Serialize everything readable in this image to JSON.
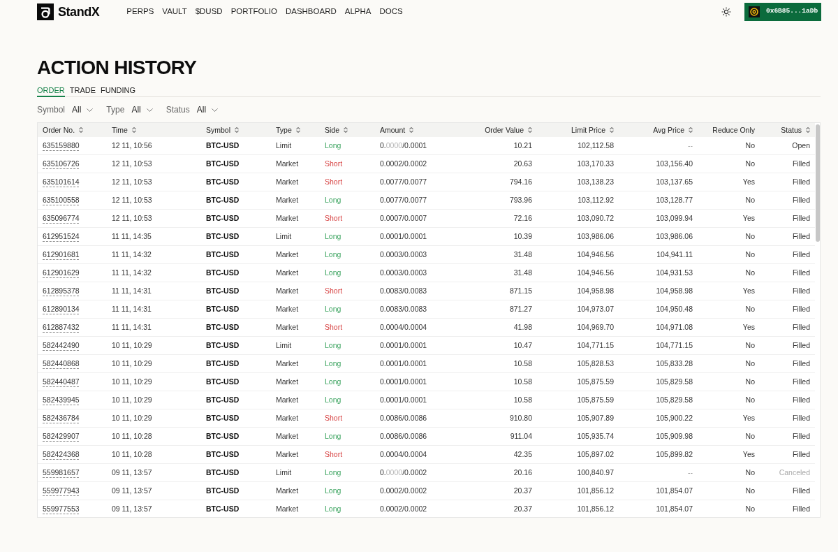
{
  "header": {
    "logo": "StandX",
    "nav": [
      "PERPS",
      "VAULT",
      "$DUSD",
      "PORTFOLIO",
      "DASHBOARD",
      "ALPHA",
      "DOCS"
    ],
    "wallet_address": "0x6B85...1aDb"
  },
  "page_title": "ACTION HISTORY",
  "tabs": [
    {
      "label": "ORDER",
      "selected": true
    },
    {
      "label": "TRADE",
      "selected": false
    },
    {
      "label": "FUNDING",
      "selected": false
    }
  ],
  "filters": [
    {
      "label": "Symbol",
      "value": "All"
    },
    {
      "label": "Type",
      "value": "All"
    },
    {
      "label": "Status",
      "value": "All"
    }
  ],
  "table": {
    "columns": [
      {
        "label": "Order No.",
        "sortable": true
      },
      {
        "label": "Time",
        "sortable": true
      },
      {
        "label": "Symbol",
        "sortable": true
      },
      {
        "label": "Type",
        "sortable": true
      },
      {
        "label": "Side",
        "sortable": true
      },
      {
        "label": "Amount",
        "sortable": true
      },
      {
        "label": "Order Value",
        "sortable": true
      },
      {
        "label": "Limit Price",
        "sortable": true
      },
      {
        "label": "Avg Price",
        "sortable": true
      },
      {
        "label": "Reduce Only",
        "sortable": false
      },
      {
        "label": "Status",
        "sortable": true
      }
    ],
    "rows": [
      {
        "order_no": "635159880",
        "time": "12 11, 10:56",
        "symbol": "BTC-USD",
        "type": "Limit",
        "side": {
          "label": "Long",
          "color": "#3aa35e"
        },
        "amount": [
          {
            "text": "0.",
            "faded": false
          },
          {
            "text": "0000",
            "faded": true
          },
          {
            "text": "/0.0001",
            "faded": false
          }
        ],
        "order_value": "10.21",
        "limit_price": "102,112.58",
        "avg_price": "--",
        "avg_muted": true,
        "reduce_only": "No",
        "status": "Open",
        "status_muted": false
      },
      {
        "order_no": "635106726",
        "time": "12 11, 10:53",
        "symbol": "BTC-USD",
        "type": "Market",
        "side": {
          "label": "Short",
          "color": "#d63f3f"
        },
        "amount": [
          {
            "text": "0.0002/0.0002",
            "faded": false
          }
        ],
        "order_value": "20.63",
        "limit_price": "103,170.33",
        "avg_price": "103,156.40",
        "avg_muted": false,
        "reduce_only": "No",
        "status": "Filled",
        "status_muted": false
      },
      {
        "order_no": "635101614",
        "time": "12 11, 10:53",
        "symbol": "BTC-USD",
        "type": "Market",
        "side": {
          "label": "Short",
          "color": "#d63f3f"
        },
        "amount": [
          {
            "text": "0.0077/0.0077",
            "faded": false
          }
        ],
        "order_value": "794.16",
        "limit_price": "103,138.23",
        "avg_price": "103,137.65",
        "avg_muted": false,
        "reduce_only": "Yes",
        "status": "Filled",
        "status_muted": false
      },
      {
        "order_no": "635100558",
        "time": "12 11, 10:53",
        "symbol": "BTC-USD",
        "type": "Market",
        "side": {
          "label": "Long",
          "color": "#3aa35e"
        },
        "amount": [
          {
            "text": "0.0077/0.0077",
            "faded": false
          }
        ],
        "order_value": "793.96",
        "limit_price": "103,112.92",
        "avg_price": "103,128.77",
        "avg_muted": false,
        "reduce_only": "No",
        "status": "Filled",
        "status_muted": false
      },
      {
        "order_no": "635096774",
        "time": "12 11, 10:53",
        "symbol": "BTC-USD",
        "type": "Market",
        "side": {
          "label": "Short",
          "color": "#d63f3f"
        },
        "amount": [
          {
            "text": "0.0007/0.0007",
            "faded": false
          }
        ],
        "order_value": "72.16",
        "limit_price": "103,090.72",
        "avg_price": "103,099.94",
        "avg_muted": false,
        "reduce_only": "Yes",
        "status": "Filled",
        "status_muted": false
      },
      {
        "order_no": "612951524",
        "time": "11 11, 14:35",
        "symbol": "BTC-USD",
        "type": "Limit",
        "side": {
          "label": "Long",
          "color": "#3aa35e"
        },
        "amount": [
          {
            "text": "0.0001/0.0001",
            "faded": false
          }
        ],
        "order_value": "10.39",
        "limit_price": "103,986.06",
        "avg_price": "103,986.06",
        "avg_muted": false,
        "reduce_only": "No",
        "status": "Filled",
        "status_muted": false
      },
      {
        "order_no": "612901681",
        "time": "11 11, 14:32",
        "symbol": "BTC-USD",
        "type": "Market",
        "side": {
          "label": "Long",
          "color": "#3aa35e"
        },
        "amount": [
          {
            "text": "0.0003/0.0003",
            "faded": false
          }
        ],
        "order_value": "31.48",
        "limit_price": "104,946.56",
        "avg_price": "104,941.11",
        "avg_muted": false,
        "reduce_only": "No",
        "status": "Filled",
        "status_muted": false
      },
      {
        "order_no": "612901629",
        "time": "11 11, 14:32",
        "symbol": "BTC-USD",
        "type": "Market",
        "side": {
          "label": "Long",
          "color": "#3aa35e"
        },
        "amount": [
          {
            "text": "0.0003/0.0003",
            "faded": false
          }
        ],
        "order_value": "31.48",
        "limit_price": "104,946.56",
        "avg_price": "104,931.53",
        "avg_muted": false,
        "reduce_only": "No",
        "status": "Filled",
        "status_muted": false
      },
      {
        "order_no": "612895378",
        "time": "11 11, 14:31",
        "symbol": "BTC-USD",
        "type": "Market",
        "side": {
          "label": "Short",
          "color": "#d63f3f"
        },
        "amount": [
          {
            "text": "0.0083/0.0083",
            "faded": false
          }
        ],
        "order_value": "871.15",
        "limit_price": "104,958.98",
        "avg_price": "104,958.98",
        "avg_muted": false,
        "reduce_only": "Yes",
        "status": "Filled",
        "status_muted": false
      },
      {
        "order_no": "612890134",
        "time": "11 11, 14:31",
        "symbol": "BTC-USD",
        "type": "Market",
        "side": {
          "label": "Long",
          "color": "#3aa35e"
        },
        "amount": [
          {
            "text": "0.0083/0.0083",
            "faded": false
          }
        ],
        "order_value": "871.27",
        "limit_price": "104,973.07",
        "avg_price": "104,950.48",
        "avg_muted": false,
        "reduce_only": "No",
        "status": "Filled",
        "status_muted": false
      },
      {
        "order_no": "612887432",
        "time": "11 11, 14:31",
        "symbol": "BTC-USD",
        "type": "Market",
        "side": {
          "label": "Short",
          "color": "#d63f3f"
        },
        "amount": [
          {
            "text": "0.0004/0.0004",
            "faded": false
          }
        ],
        "order_value": "41.98",
        "limit_price": "104,969.70",
        "avg_price": "104,971.08",
        "avg_muted": false,
        "reduce_only": "Yes",
        "status": "Filled",
        "status_muted": false
      },
      {
        "order_no": "582442490",
        "time": "10 11, 10:29",
        "symbol": "BTC-USD",
        "type": "Limit",
        "side": {
          "label": "Long",
          "color": "#3aa35e"
        },
        "amount": [
          {
            "text": "0.0001/0.0001",
            "faded": false
          }
        ],
        "order_value": "10.47",
        "limit_price": "104,771.15",
        "avg_price": "104,771.15",
        "avg_muted": false,
        "reduce_only": "No",
        "status": "Filled",
        "status_muted": false
      },
      {
        "order_no": "582440868",
        "time": "10 11, 10:29",
        "symbol": "BTC-USD",
        "type": "Market",
        "side": {
          "label": "Long",
          "color": "#3aa35e"
        },
        "amount": [
          {
            "text": "0.0001/0.0001",
            "faded": false
          }
        ],
        "order_value": "10.58",
        "limit_price": "105,828.53",
        "avg_price": "105,833.28",
        "avg_muted": false,
        "reduce_only": "No",
        "status": "Filled",
        "status_muted": false
      },
      {
        "order_no": "582440487",
        "time": "10 11, 10:29",
        "symbol": "BTC-USD",
        "type": "Market",
        "side": {
          "label": "Long",
          "color": "#3aa35e"
        },
        "amount": [
          {
            "text": "0.0001/0.0001",
            "faded": false
          }
        ],
        "order_value": "10.58",
        "limit_price": "105,875.59",
        "avg_price": "105,829.58",
        "avg_muted": false,
        "reduce_only": "No",
        "status": "Filled",
        "status_muted": false
      },
      {
        "order_no": "582439945",
        "time": "10 11, 10:29",
        "symbol": "BTC-USD",
        "type": "Market",
        "side": {
          "label": "Long",
          "color": "#3aa35e"
        },
        "amount": [
          {
            "text": "0.0001/0.0001",
            "faded": false
          }
        ],
        "order_value": "10.58",
        "limit_price": "105,875.59",
        "avg_price": "105,829.58",
        "avg_muted": false,
        "reduce_only": "No",
        "status": "Filled",
        "status_muted": false
      },
      {
        "order_no": "582436784",
        "time": "10 11, 10:29",
        "symbol": "BTC-USD",
        "type": "Market",
        "side": {
          "label": "Short",
          "color": "#d63f3f"
        },
        "amount": [
          {
            "text": "0.0086/0.0086",
            "faded": false
          }
        ],
        "order_value": "910.80",
        "limit_price": "105,907.89",
        "avg_price": "105,900.22",
        "avg_muted": false,
        "reduce_only": "Yes",
        "status": "Filled",
        "status_muted": false
      },
      {
        "order_no": "582429907",
        "time": "10 11, 10:28",
        "symbol": "BTC-USD",
        "type": "Market",
        "side": {
          "label": "Long",
          "color": "#3aa35e"
        },
        "amount": [
          {
            "text": "0.0086/0.0086",
            "faded": false
          }
        ],
        "order_value": "911.04",
        "limit_price": "105,935.74",
        "avg_price": "105,909.98",
        "avg_muted": false,
        "reduce_only": "No",
        "status": "Filled",
        "status_muted": false
      },
      {
        "order_no": "582424368",
        "time": "10 11, 10:28",
        "symbol": "BTC-USD",
        "type": "Market",
        "side": {
          "label": "Short",
          "color": "#d63f3f"
        },
        "amount": [
          {
            "text": "0.0004/0.0004",
            "faded": false
          }
        ],
        "order_value": "42.35",
        "limit_price": "105,897.02",
        "avg_price": "105,899.82",
        "avg_muted": false,
        "reduce_only": "Yes",
        "status": "Filled",
        "status_muted": false
      },
      {
        "order_no": "559981657",
        "time": "09 11, 13:57",
        "symbol": "BTC-USD",
        "type": "Limit",
        "side": {
          "label": "Long",
          "color": "#3aa35e"
        },
        "amount": [
          {
            "text": "0.",
            "faded": false
          },
          {
            "text": "0000",
            "faded": true
          },
          {
            "text": "/0.0002",
            "faded": false
          }
        ],
        "order_value": "20.16",
        "limit_price": "100,840.97",
        "avg_price": "--",
        "avg_muted": true,
        "reduce_only": "No",
        "status": "Canceled",
        "status_muted": true
      },
      {
        "order_no": "559977943",
        "time": "09 11, 13:57",
        "symbol": "BTC-USD",
        "type": "Market",
        "side": {
          "label": "Long",
          "color": "#3aa35e"
        },
        "amount": [
          {
            "text": "0.0002/0.0002",
            "faded": false
          }
        ],
        "order_value": "20.37",
        "limit_price": "101,856.12",
        "avg_price": "101,854.07",
        "avg_muted": false,
        "reduce_only": "No",
        "status": "Filled",
        "status_muted": false
      },
      {
        "order_no": "559977553",
        "time": "09 11, 13:57",
        "symbol": "BTC-USD",
        "type": "Market",
        "side": {
          "label": "Long",
          "color": "#3aa35e"
        },
        "amount": [
          {
            "text": "0.0002/0.0002",
            "faded": false
          }
        ],
        "order_value": "20.37",
        "limit_price": "101,856.12",
        "avg_price": "101,854.07",
        "avg_muted": false,
        "reduce_only": "No",
        "status": "Filled",
        "status_muted": false
      }
    ]
  }
}
